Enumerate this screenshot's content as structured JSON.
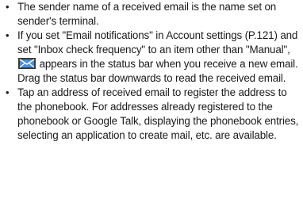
{
  "notes": [
    {
      "bullet": "•",
      "text": "The sender name of a received email is the name set on sender's terminal."
    },
    {
      "bullet": "•",
      "text_before": "If you set \"Email notifications\" in Account settings (P.121) and set \"Inbox check frequency\" to an item other than \"Manual\",",
      "icon": "email-notification-icon",
      "text_after": "appears in the status bar when you receive a new email. Drag the status bar downwards to read the received email."
    },
    {
      "bullet": "•",
      "text": "Tap an address of received email to register the address to the phonebook. For addresses already registered to the phonebook or Google Talk, displaying the phonebook entries, selecting an application to create mail, etc. are available."
    }
  ],
  "colors": {
    "text": "#1a1a1a",
    "icon_bg": "#3a3a3a",
    "icon_envelope": "#4a8fd6"
  }
}
